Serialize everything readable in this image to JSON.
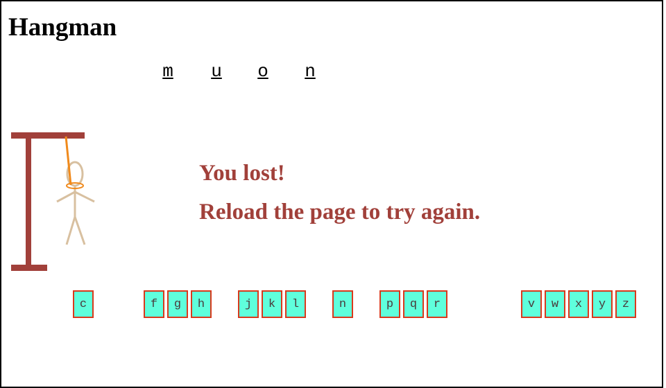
{
  "title": "Hangman",
  "word": [
    "m",
    "u",
    "o",
    "n"
  ],
  "message": {
    "line1": "You lost!",
    "line2": "Reload the page to try again."
  },
  "remaining_letters": [
    "c",
    "f",
    "g",
    "h",
    "j",
    "k",
    "l",
    "n",
    "p",
    "q",
    "r",
    "v",
    "w",
    "x",
    "y",
    "z"
  ],
  "colors": {
    "gallows": "#a1403a",
    "rope": "#f08a1c",
    "figure": "#d8c0a0",
    "key_fill": "#5fffdc",
    "key_border": "#d9391c",
    "message": "#a1403a"
  }
}
